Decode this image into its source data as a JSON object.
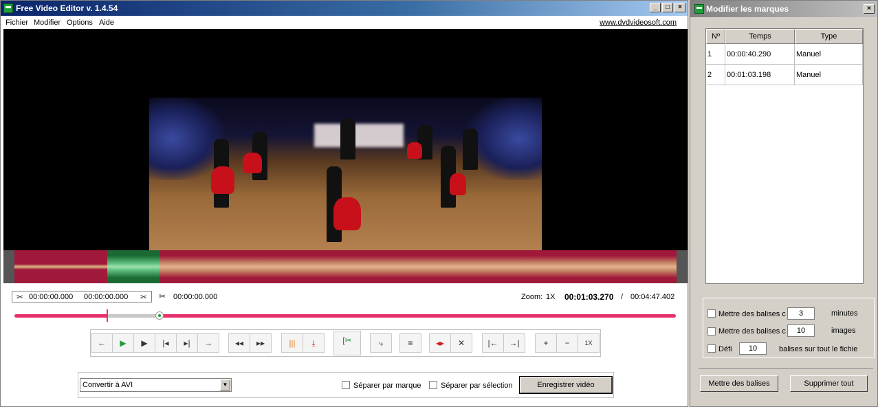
{
  "app": {
    "title": "Free Video Editor v. 1.4.54",
    "window_buttons": [
      "0",
      "1",
      "r"
    ],
    "menu": [
      "Fichier",
      "Modifier",
      "Options",
      "Aide"
    ],
    "website_link": "www.dvdvideosoft.com"
  },
  "timeline": {
    "selection_start": "00:00:00.000",
    "selection_end": "00:00:00.000",
    "cut_time": "00:00:00.000",
    "zoom_label": "Zoom:",
    "zoom_value": "1X",
    "current_time": "00:01:03.270",
    "separator": "/",
    "total_time": "00:04:47.402",
    "position_fraction": 0.22
  },
  "toolbar": {
    "zoom_in": "+",
    "zoom_out": "−",
    "zoom_reset": "1X"
  },
  "output": {
    "format_selected": "Convertir à AVI",
    "split_by_marker": "Séparer par marque",
    "split_by_selection": "Séparer par sélection",
    "save_video": "Enregistrer vidéo"
  },
  "markers_panel": {
    "title": "Modifier les marques",
    "columns": [
      "Nº",
      "Temps",
      "Type"
    ],
    "rows": [
      {
        "no": "1",
        "time": "00:00:40.290",
        "type": "Manuel"
      },
      {
        "no": "2",
        "time": "00:01:03.198",
        "type": "Manuel"
      }
    ],
    "option_minutes_label": "Mettre des balises c",
    "option_minutes_value": "3",
    "option_minutes_unit": "minutes",
    "option_frames_label": "Mettre des balises c",
    "option_frames_value": "10",
    "option_frames_unit": "images",
    "option_define_label": "Défi",
    "option_define_value": "10",
    "option_define_suffix": "balises sur tout le fichie",
    "set_markers_button": "Mettre des balises",
    "delete_all_button": "Supprimer tout"
  }
}
